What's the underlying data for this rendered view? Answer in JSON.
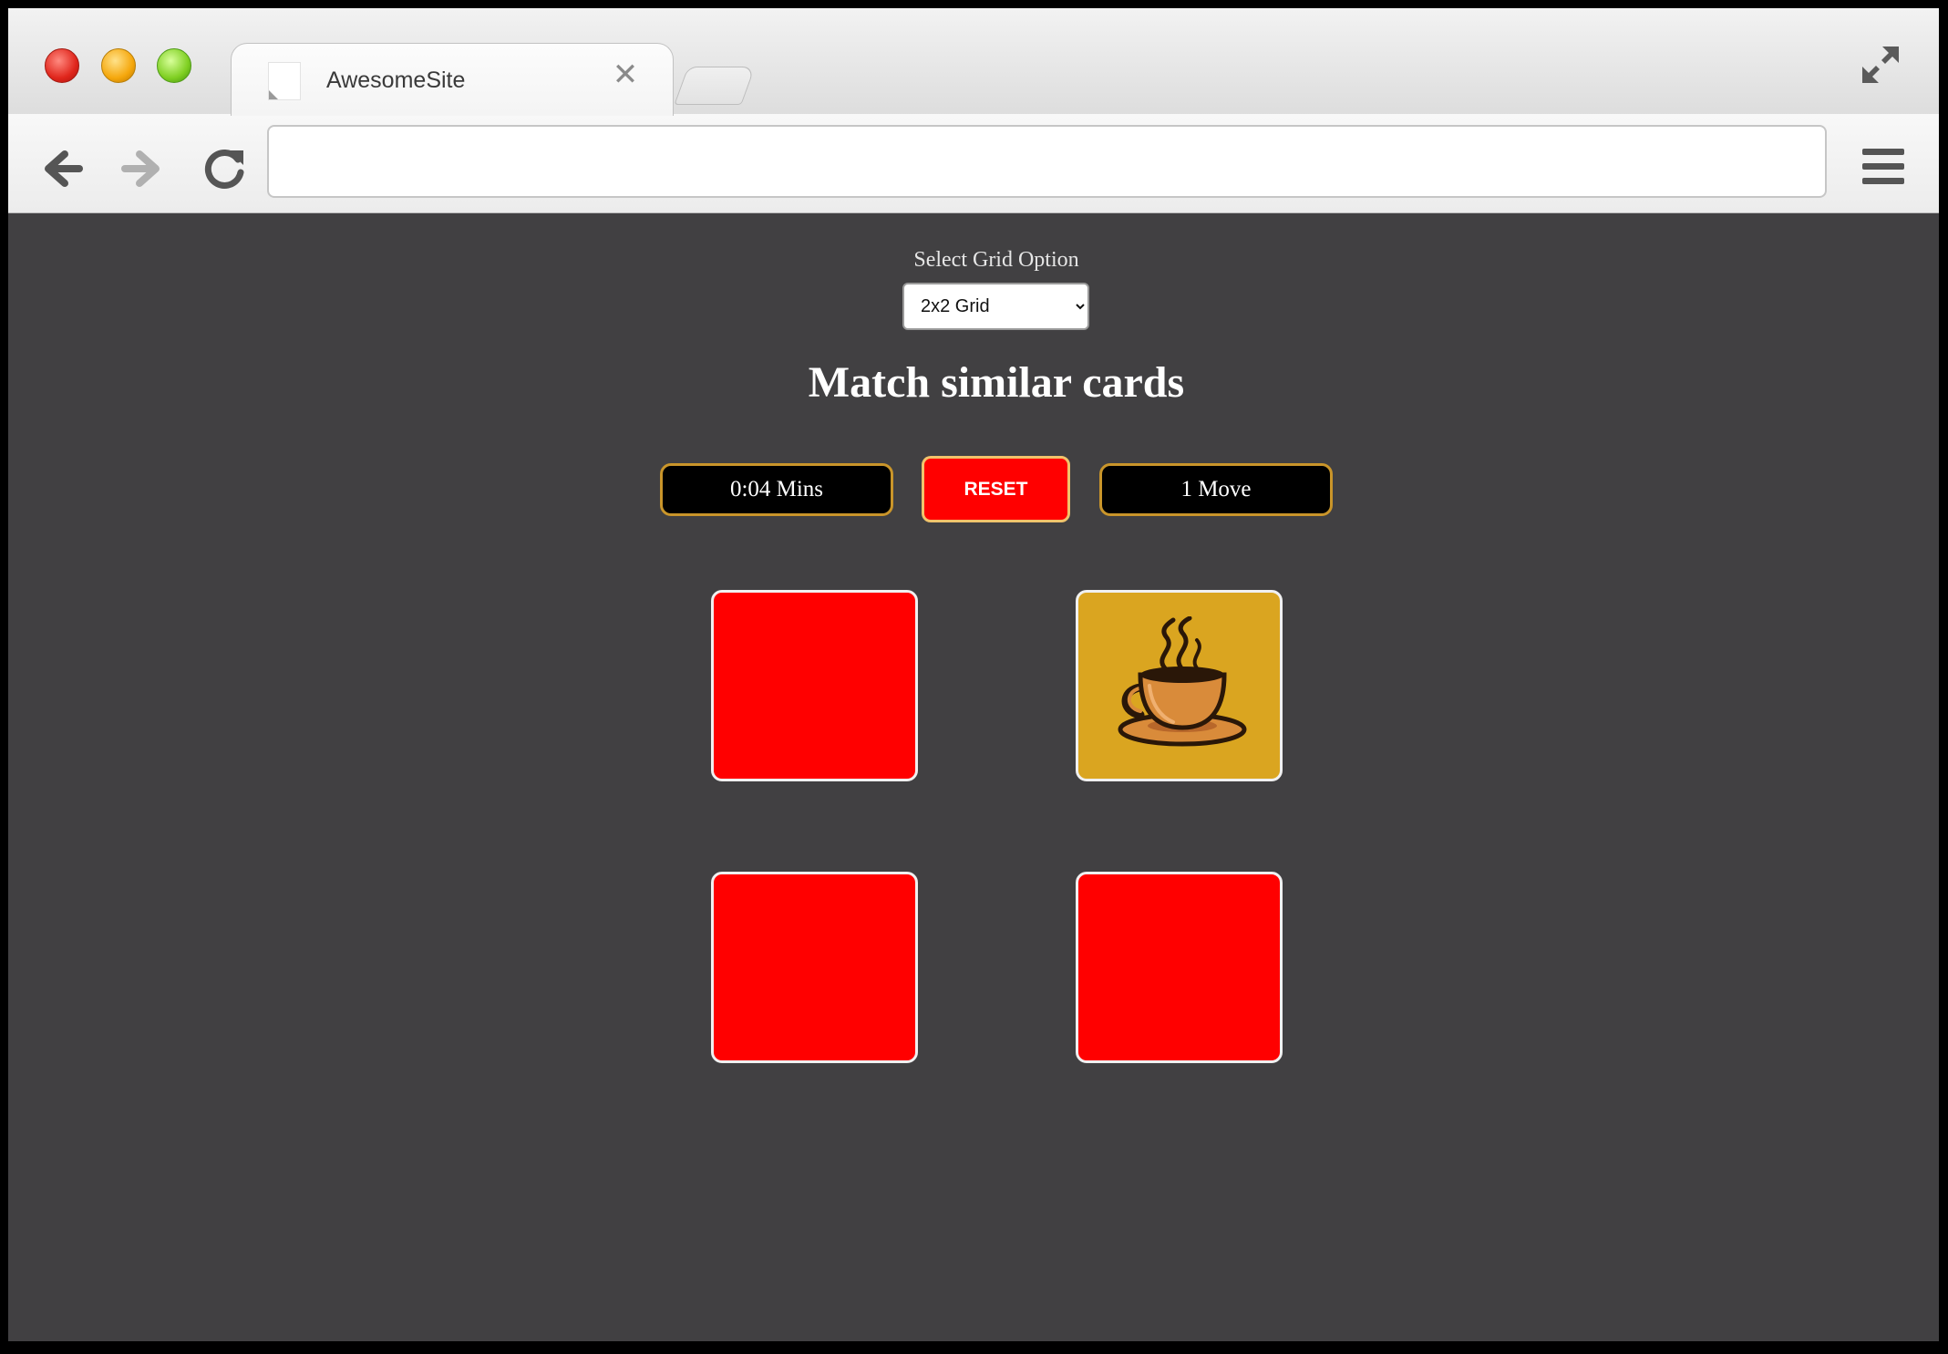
{
  "browser": {
    "tab_title": "AwesomeSite",
    "close_symbol": "✕",
    "address_value": ""
  },
  "game": {
    "grid_label": "Select Grid Option",
    "grid_options": [
      "2x2 Grid"
    ],
    "selected_grid": "2x2 Grid",
    "title": "Match similar cards",
    "timer_text": "0:04 Mins",
    "reset_label": "RESET",
    "moves_text": "1 Move",
    "colors": {
      "background": "#414042",
      "card_back": "#ff0000",
      "card_face": "#daa520",
      "stat_border": "#c9952a"
    },
    "cards": [
      {
        "state": "face-down",
        "icon": ""
      },
      {
        "state": "face-up",
        "icon": "coffee-cup-icon"
      },
      {
        "state": "face-down",
        "icon": ""
      },
      {
        "state": "face-down",
        "icon": ""
      }
    ]
  }
}
